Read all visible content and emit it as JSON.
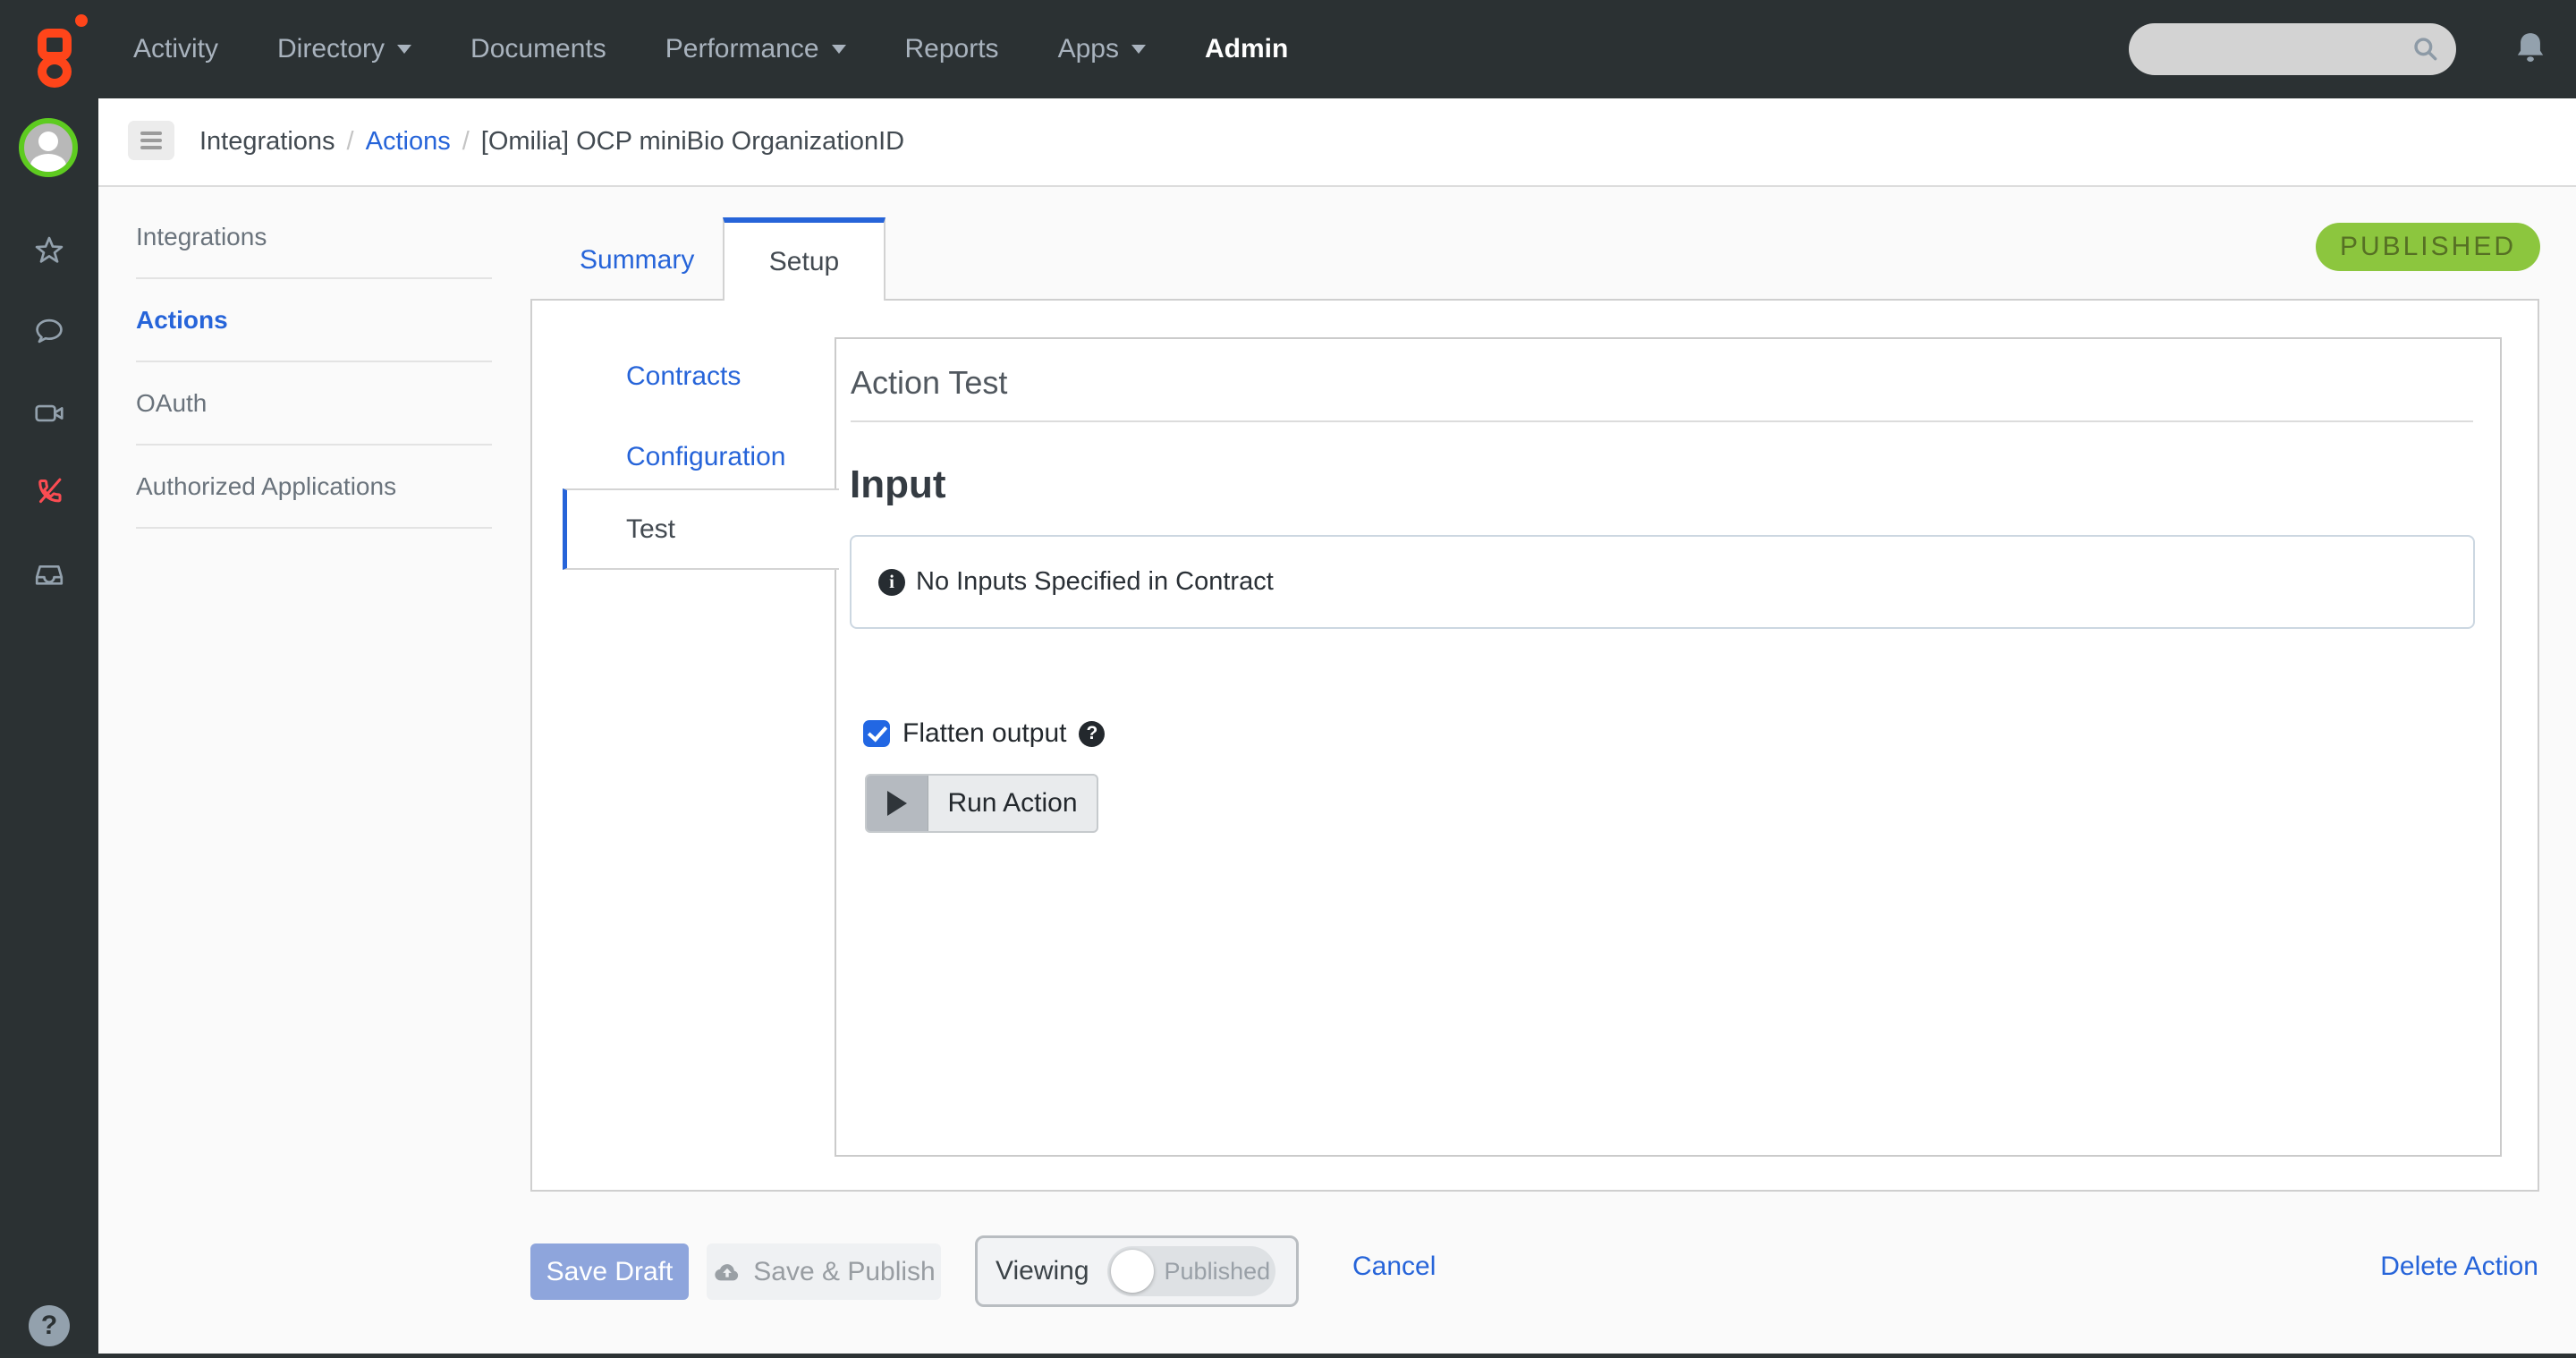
{
  "topnav": {
    "items": [
      {
        "label": "Activity",
        "caret": false,
        "active": false
      },
      {
        "label": "Directory",
        "caret": true,
        "active": false
      },
      {
        "label": "Documents",
        "caret": false,
        "active": false
      },
      {
        "label": "Performance",
        "caret": true,
        "active": false
      },
      {
        "label": "Reports",
        "caret": false,
        "active": false
      },
      {
        "label": "Apps",
        "caret": true,
        "active": false
      },
      {
        "label": "Admin",
        "caret": false,
        "active": true
      }
    ],
    "search": {
      "value": "",
      "placeholder": ""
    }
  },
  "sidebar": {
    "icons": [
      "user-avatar",
      "favorites-star",
      "chat",
      "video-call",
      "phone-disabled",
      "inbox",
      "help"
    ]
  },
  "breadcrumb": {
    "separator": "/",
    "items": [
      {
        "label": "Integrations",
        "link": false
      },
      {
        "label": "Actions",
        "link": true
      },
      {
        "label": "[Omilia] OCP miniBio OrganizationID",
        "link": false
      }
    ]
  },
  "nav_menu": {
    "items": [
      {
        "label": "Integrations",
        "active": false
      },
      {
        "label": "Actions",
        "active": true
      },
      {
        "label": "OAuth",
        "active": false
      },
      {
        "label": "Authorized Applications",
        "active": false
      }
    ]
  },
  "tabs": {
    "items": [
      {
        "label": "Summary",
        "active": false
      },
      {
        "label": "Setup",
        "active": true
      }
    ]
  },
  "status_badge": {
    "label": "PUBLISHED"
  },
  "setup_nav": {
    "items": [
      {
        "label": "Contracts",
        "active": false
      },
      {
        "label": "Configuration",
        "active": false
      },
      {
        "label": "Test",
        "active": true
      }
    ]
  },
  "test_panel": {
    "title": "Action Test",
    "input_heading": "Input",
    "empty_notice": "No Inputs Specified in Contract",
    "flatten_checkbox": {
      "label": "Flatten output",
      "checked": true
    },
    "run_button": "Run Action"
  },
  "footer": {
    "save_draft": "Save Draft",
    "save_publish": "Save & Publish",
    "viewing_label": "Viewing",
    "viewing_state": "Published",
    "cancel": "Cancel",
    "delete_action": "Delete Action"
  },
  "icons": {
    "info": "i",
    "help": "?",
    "rail_help": "?"
  },
  "colors": {
    "accent_blue": "#2664d9",
    "badge_green": "#8cc63e",
    "brand_orange": "#ff451a",
    "save_draft_blue": "#8ea5dc"
  }
}
